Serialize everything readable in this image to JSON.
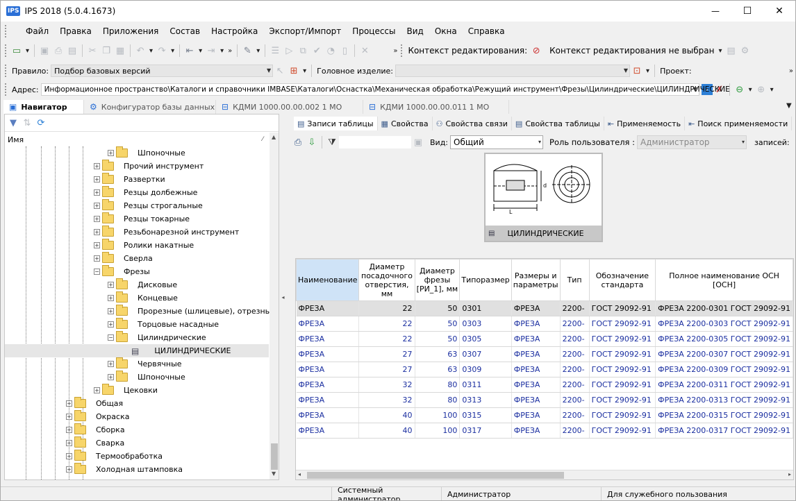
{
  "window": {
    "title": "IPS 2018 (5.0.4.1673)",
    "logo": "IPS",
    "min": "—",
    "max": "☐",
    "close": "✕"
  },
  "menu": [
    "Файл",
    "Правка",
    "Приложения",
    "Состав",
    "Настройка",
    "Экспорт/Импорт",
    "Процессы",
    "Вид",
    "Окна",
    "Справка"
  ],
  "toolbar1": {
    "context_label": "Контекст редактирования:",
    "context_value": "Контекст редактирования не выбран"
  },
  "toolbar2": {
    "rule_label": "Правило:",
    "rule_value": "Подбор базовых версий",
    "head_label": "Головное изделие:",
    "head_value": "",
    "project_label": "Проект:"
  },
  "address": {
    "label": "Адрес:",
    "value": "Информационное пространство\\Каталоги и справочники IMBASE\\Каталоги\\Оснастка\\Механическая обработка\\Режущий инструмент\\Фрезы\\Цилиндрические\\ЦИЛИНДРИЧЕСКИЕ"
  },
  "doc_tabs": [
    "Навигатор",
    "Конфигуратор базы данных",
    "КДМИ 1000.00.00.002 1 МО",
    "КДМИ 1000.00.00.011 1 МО"
  ],
  "tree": {
    "header": "Имя",
    "items": [
      {
        "label": "Шпоночные",
        "level": 3
      },
      {
        "label": "Прочий инструмент",
        "level": 2
      },
      {
        "label": "Развертки",
        "level": 2
      },
      {
        "label": "Резцы долбежные",
        "level": 2
      },
      {
        "label": "Резцы строгальные",
        "level": 2
      },
      {
        "label": "Резцы токарные",
        "level": 2
      },
      {
        "label": "Резьбонарезной инструмент",
        "level": 2
      },
      {
        "label": "Ролики накатные",
        "level": 2
      },
      {
        "label": "Сверла",
        "level": 2
      },
      {
        "label": "Фрезы",
        "level": 2
      },
      {
        "label": "Дисковые",
        "level": 3
      },
      {
        "label": "Концевые",
        "level": 3
      },
      {
        "label": "Прорезные (шлицевые), отрезные",
        "level": 3
      },
      {
        "label": "Торцовые насадные",
        "level": 3
      },
      {
        "label": "Цилиндрические",
        "level": 3
      },
      {
        "label": "ЦИЛИНДРИЧЕСКИЕ",
        "level": 4
      },
      {
        "label": "Червячные",
        "level": 3
      },
      {
        "label": "Шпоночные",
        "level": 3
      },
      {
        "label": "Цековки",
        "level": 2
      },
      {
        "label": "Общая",
        "level": 1
      },
      {
        "label": "Окраска",
        "level": 1
      },
      {
        "label": "Сборка",
        "level": 1
      },
      {
        "label": "Сварка",
        "level": 1
      },
      {
        "label": "Термообработка",
        "level": 1
      },
      {
        "label": "Холодная штамповка",
        "level": 1
      }
    ]
  },
  "right_tabs": [
    "Записи таблицы",
    "Свойства",
    "Свойства связи",
    "Свойства таблицы",
    "Применяемость",
    "Поиск применяемости"
  ],
  "filter_bar": {
    "view_label": "Вид:",
    "view_value": "Общий",
    "role_label": "Роль пользователя :",
    "role_value": "Администратор",
    "records_label": "записей:"
  },
  "preview_caption": "ЦИЛИНДРИЧЕСКИЕ",
  "table": {
    "columns": [
      "Наименование",
      "Диаметр посадочного отверстия, мм",
      "Диаметр фрезы [РИ_1], мм",
      "Типоразмер",
      "Размеры и параметры",
      "Тип",
      "Обозначение стандарта",
      "Полное наименование ОСН [ОСН]"
    ],
    "rows": [
      [
        "ФРЕЗА",
        "22",
        "50",
        "0301",
        "ФРЕЗА",
        "2200-",
        "ГОСТ 29092-91",
        "ФРЕЗА 2200-0301 ГОСТ 29092-91"
      ],
      [
        "ФРЕЗА",
        "22",
        "50",
        "0303",
        "ФРЕЗА",
        "2200-",
        "ГОСТ 29092-91",
        "ФРЕЗА 2200-0303 ГОСТ 29092-91"
      ],
      [
        "ФРЕЗА",
        "22",
        "50",
        "0305",
        "ФРЕЗА",
        "2200-",
        "ГОСТ 29092-91",
        "ФРЕЗА 2200-0305 ГОСТ 29092-91"
      ],
      [
        "ФРЕЗА",
        "27",
        "63",
        "0307",
        "ФРЕЗА",
        "2200-",
        "ГОСТ 29092-91",
        "ФРЕЗА 2200-0307 ГОСТ 29092-91"
      ],
      [
        "ФРЕЗА",
        "27",
        "63",
        "0309",
        "ФРЕЗА",
        "2200-",
        "ГОСТ 29092-91",
        "ФРЕЗА 2200-0309 ГОСТ 29092-91"
      ],
      [
        "ФРЕЗА",
        "32",
        "80",
        "0311",
        "ФРЕЗА",
        "2200-",
        "ГОСТ 29092-91",
        "ФРЕЗА 2200-0311 ГОСТ 29092-91"
      ],
      [
        "ФРЕЗА",
        "32",
        "80",
        "0313",
        "ФРЕЗА",
        "2200-",
        "ГОСТ 29092-91",
        "ФРЕЗА 2200-0313 ГОСТ 29092-91"
      ],
      [
        "ФРЕЗА",
        "40",
        "100",
        "0315",
        "ФРЕЗА",
        "2200-",
        "ГОСТ 29092-91",
        "ФРЕЗА 2200-0315 ГОСТ 29092-91"
      ],
      [
        "ФРЕЗА",
        "40",
        "100",
        "0317",
        "ФРЕЗА",
        "2200-",
        "ГОСТ 29092-91",
        "ФРЕЗА 2200-0317 ГОСТ 29092-91"
      ]
    ]
  },
  "status": [
    "Системный администратор",
    "Администратор",
    "Для служебного пользования"
  ]
}
